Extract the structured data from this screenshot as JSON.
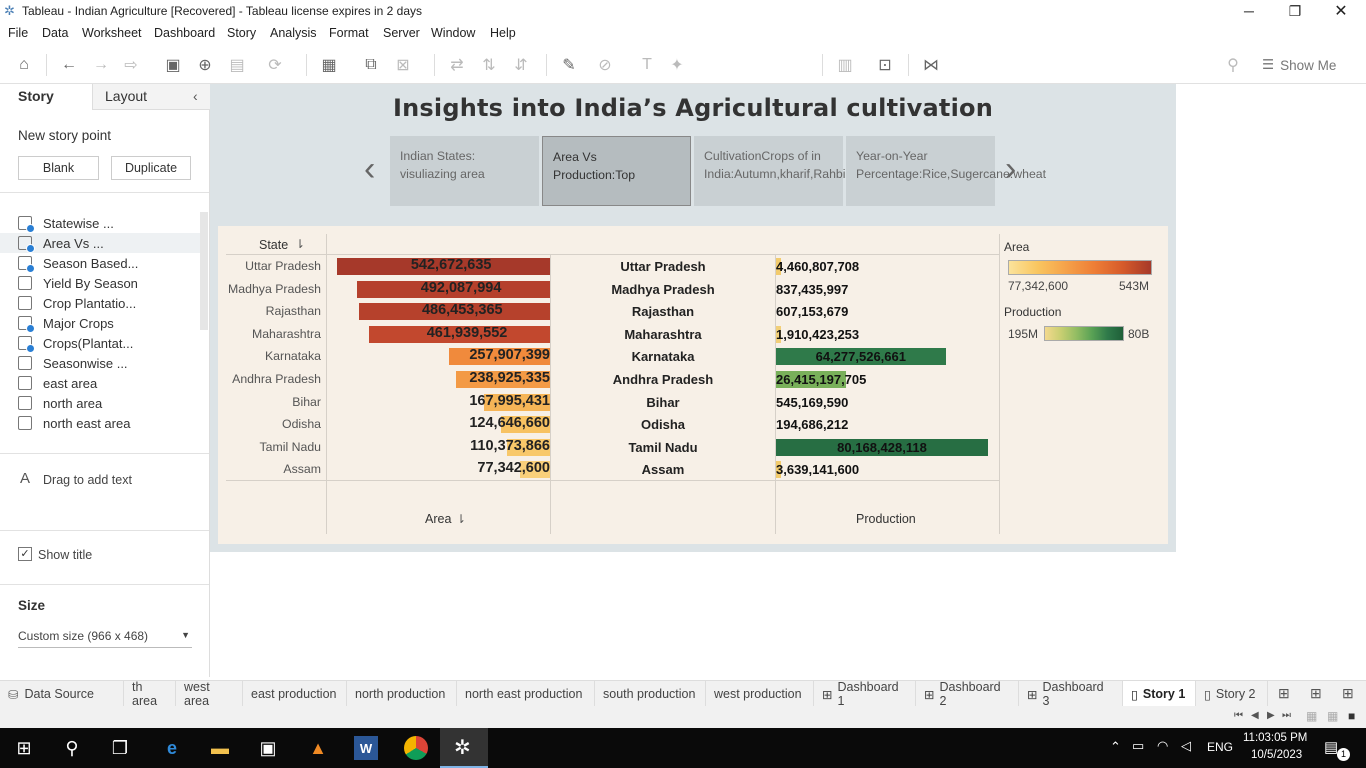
{
  "window": {
    "title": "Tableau - Indian Agriculture [Recovered] - Tableau license expires in 2 days"
  },
  "menu": [
    "File",
    "Data",
    "Worksheet",
    "Dashboard",
    "Story",
    "Analysis",
    "Format",
    "Server",
    "Window",
    "Help"
  ],
  "toolbar": {
    "show_me": "Show Me"
  },
  "left_pane": {
    "tabs": {
      "story": "Story",
      "layout": "Layout"
    },
    "new_story_point": "New story point",
    "blank_button": "Blank",
    "duplicate_button": "Duplicate",
    "sheets": [
      "Statewise ...",
      "Area Vs ...",
      "Season Based...",
      "Yield By Season",
      "Crop Plantatio...",
      "Major Crops",
      "Crops(Plantat...",
      "Seasonwise ...",
      "east area",
      "north area",
      "north east area"
    ],
    "drag_text": "Drag to add text",
    "show_title": "Show title",
    "size_label": "Size",
    "size_value": "Custom size (966 x 468)"
  },
  "story": {
    "title": "Insights into India’s Agricultural cultivation",
    "points": [
      "Indian States: visuliazing area",
      "Area Vs Production:Top",
      "CultivationCrops  of in India:Autumn,kharif,Rahbi.Summer.Winter",
      "Year-on-Year Percentage:Rice,Sugercane.wheat"
    ]
  },
  "viz": {
    "state_header": "State",
    "area_axis": "Area",
    "production_axis": "Production",
    "rows": [
      {
        "state": "Uttar Pradesh",
        "area": "542,672,635",
        "production": "4,460,807,708",
        "area_color": "#a6392a",
        "prod_color": "#f2cb6d",
        "area_frac": 1.0,
        "prod_frac": 0.015
      },
      {
        "state": "Madhya Pradesh",
        "area": "492,087,994",
        "production": "837,435,997",
        "area_color": "#b5402c",
        "prod_color": "#f4d98e",
        "area_frac": 0.907,
        "prod_frac": 0.0
      },
      {
        "state": "Rajasthan",
        "area": "486,453,365",
        "production": "607,153,679",
        "area_color": "#b6412c",
        "prod_color": "#f4d98e",
        "area_frac": 0.896,
        "prod_frac": 0.0
      },
      {
        "state": "Maharashtra",
        "area": "461,939,552",
        "production": "1,910,423,253",
        "area_color": "#c2482e",
        "prod_color": "#f2cf78",
        "area_frac": 0.851,
        "prod_frac": 0.006
      },
      {
        "state": "Karnataka",
        "area": "257,907,399",
        "production": "64,277,526,661",
        "area_color": "#f08a3c",
        "prod_color": "#2f7a4a",
        "area_frac": 0.475,
        "prod_frac": 0.8
      },
      {
        "state": "Andhra Pradesh",
        "area": "238,925,335",
        "production": "26,415,197,705",
        "area_color": "#f39a45",
        "prod_color": "#79b05a",
        "area_frac": 0.44,
        "prod_frac": 0.33
      },
      {
        "state": "Bihar",
        "area": "167,995,431",
        "production": "545,169,590",
        "area_color": "#f6b557",
        "prod_color": "#f4d98e",
        "area_frac": 0.31,
        "prod_frac": 0.0
      },
      {
        "state": "Odisha",
        "area": "124,646,660",
        "production": "194,686,212",
        "area_color": "#f7c262",
        "prod_color": "#f4d98e",
        "area_frac": 0.23,
        "prod_frac": 0.0
      },
      {
        "state": "Tamil Nadu",
        "area": "110,373,866",
        "production": "80,168,428,118",
        "area_color": "#f8c86a",
        "prod_color": "#276e43",
        "area_frac": 0.203,
        "prod_frac": 1.0
      },
      {
        "state": "Assam",
        "area": "77,342,600",
        "production": "3,639,141,600",
        "area_color": "#f9d07a",
        "prod_color": "#f2cb6d",
        "area_frac": 0.143,
        "prod_frac": 0.012
      }
    ],
    "legend": {
      "area_title": "Area",
      "area_min": "77,342,600",
      "area_max": "543M",
      "prod_title": "Production",
      "prod_min": "195M",
      "prod_max": "80B"
    }
  },
  "sheet_tabs": [
    "Data Source",
    "th area",
    "west area",
    "east production",
    "north production",
    "north east production",
    "south production",
    "west production",
    "Dashboard 1",
    "Dashboard 2",
    "Dashboard 3",
    "Story 1",
    "Story 2"
  ],
  "taskbar": {
    "lang": "ENG",
    "time": "11:03:05 PM",
    "date": "10/5/2023",
    "notifications": "1"
  }
}
